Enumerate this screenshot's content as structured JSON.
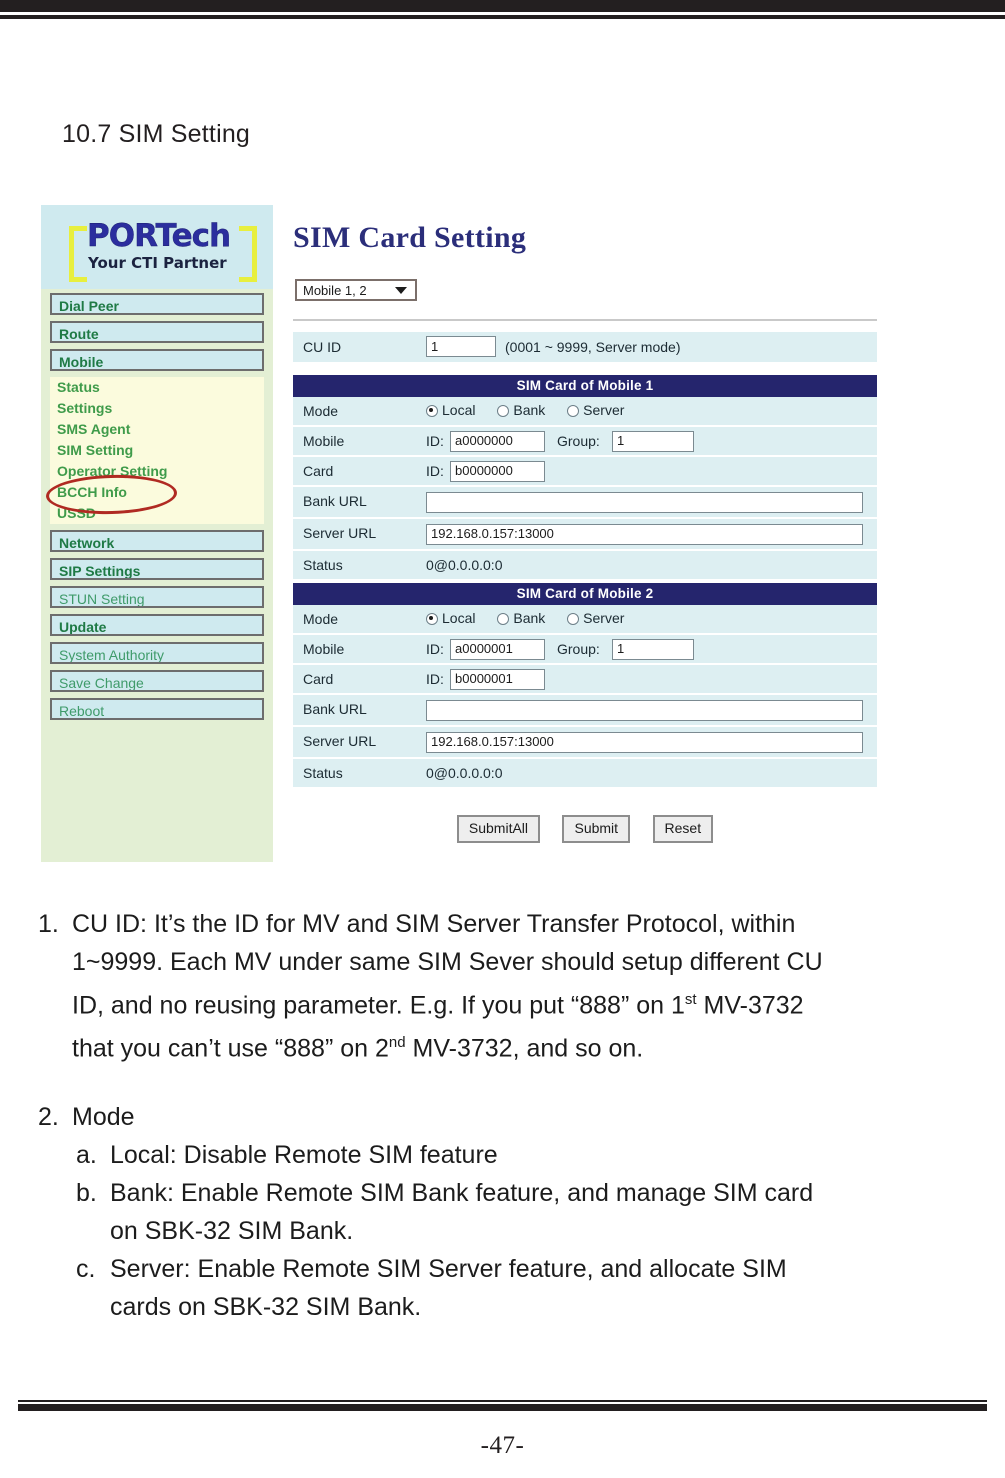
{
  "document": {
    "section_heading": "10.7 SIM Setting",
    "page_number": "-47-"
  },
  "screenshot": {
    "sidebar": {
      "logo": {
        "brand": "PORTech",
        "tagline": "Your CTI Partner"
      },
      "items": [
        {
          "label": "Dial Peer",
          "type": "button",
          "bold": true
        },
        {
          "label": "Route",
          "type": "button",
          "bold": true
        },
        {
          "label": "Mobile",
          "type": "button",
          "bold": true
        },
        {
          "label": "Status",
          "type": "sub"
        },
        {
          "label": "Settings",
          "type": "sub"
        },
        {
          "label": "SMS Agent",
          "type": "sub"
        },
        {
          "label": "SIM Setting",
          "type": "sub",
          "highlighted": true
        },
        {
          "label": "Operator Setting",
          "type": "sub"
        },
        {
          "label": "BCCH Info",
          "type": "sub"
        },
        {
          "label": "USSD",
          "type": "sub"
        },
        {
          "label": "Network",
          "type": "button",
          "bold": true
        },
        {
          "label": "SIP Settings",
          "type": "button",
          "bold": true
        },
        {
          "label": "STUN Setting",
          "type": "button"
        },
        {
          "label": "Update",
          "type": "button",
          "bold": true
        },
        {
          "label": "System Authority",
          "type": "button"
        },
        {
          "label": "Save Change",
          "type": "button"
        },
        {
          "label": "Reboot",
          "type": "button"
        }
      ]
    },
    "main": {
      "title": "SIM Card Setting",
      "mobile_select": {
        "value": "Mobile 1, 2"
      },
      "cu_id": {
        "label": "CU ID",
        "value": "1",
        "hint": "(0001 ~ 9999, Server mode)"
      },
      "sections": [
        {
          "header": "SIM Card of Mobile 1",
          "mode_label": "Mode",
          "mode_options": [
            {
              "label": "Local",
              "selected": true
            },
            {
              "label": "Bank",
              "selected": false
            },
            {
              "label": "Server",
              "selected": false
            }
          ],
          "mobile_label": "Mobile",
          "mobile_id_prefix": "ID:",
          "mobile_id": "a0000000",
          "group_label": "Group:",
          "group": "1",
          "card_label": "Card",
          "card_id_prefix": "ID:",
          "card_id": "b0000000",
          "bank_url_label": "Bank URL",
          "bank_url": "",
          "server_url_label": "Server URL",
          "server_url": "192.168.0.157:13000",
          "status_label": "Status",
          "status": "0@0.0.0.0:0"
        },
        {
          "header": "SIM Card of Mobile 2",
          "mode_label": "Mode",
          "mode_options": [
            {
              "label": "Local",
              "selected": true
            },
            {
              "label": "Bank",
              "selected": false
            },
            {
              "label": "Server",
              "selected": false
            }
          ],
          "mobile_label": "Mobile",
          "mobile_id_prefix": "ID:",
          "mobile_id": "a0000001",
          "group_label": "Group:",
          "group": "1",
          "card_label": "Card",
          "card_id_prefix": "ID:",
          "card_id": "b0000001",
          "bank_url_label": "Bank URL",
          "bank_url": "",
          "server_url_label": "Server URL",
          "server_url": "192.168.0.157:13000",
          "status_label": "Status",
          "status": "0@0.0.0.0:0"
        }
      ],
      "buttons": [
        {
          "label": "SubmitAll"
        },
        {
          "label": "Submit"
        },
        {
          "label": "Reset"
        }
      ]
    }
  },
  "prose": {
    "item1_marker": "1.",
    "item1_line1": "CU ID: It’s the ID for MV and SIM Server Transfer Protocol, within",
    "item1_line2": "1~9999. Each MV under same SIM Sever should setup different CU",
    "item1_line3a": "ID, and no reusing parameter. E.g. If you put “888” on 1",
    "item1_line3sup": "st",
    "item1_line3b": " MV-3732",
    "item1_line4a": "that you can’t use “888” on 2",
    "item1_line4sup": "nd",
    "item1_line4b": " MV-3732, and so on.",
    "item2_marker": "2.",
    "item2_text": "Mode",
    "item2a_marker": "a.",
    "item2a_text": "Local: Disable Remote SIM feature",
    "item2b_marker": "b.",
    "item2b_line1": "Bank: Enable Remote SIM Bank feature, and manage SIM card",
    "item2b_line2": "on SBK-32 SIM Bank.",
    "item2c_marker": "c.",
    "item2c_line1": "Server: Enable Remote SIM Server feature, and allocate SIM",
    "item2c_line2": "cards on SBK-32 SIM Bank."
  },
  "colors": {
    "rule": "#231f20",
    "nav_panel_bg": "#e3efd4",
    "nav_button_bg": "#cfeaef",
    "nav_sub_bg": "#fbfbdd",
    "nav_text": "#1f7a45",
    "table_header_bg": "#25256d",
    "table_row_bg": "#ddeff2",
    "title_color": "#2b2e7a",
    "highlight_ellipse": "#b02a22",
    "logo_brand": "#2b2e9e",
    "logo_bracket": "#e8ef3e"
  }
}
